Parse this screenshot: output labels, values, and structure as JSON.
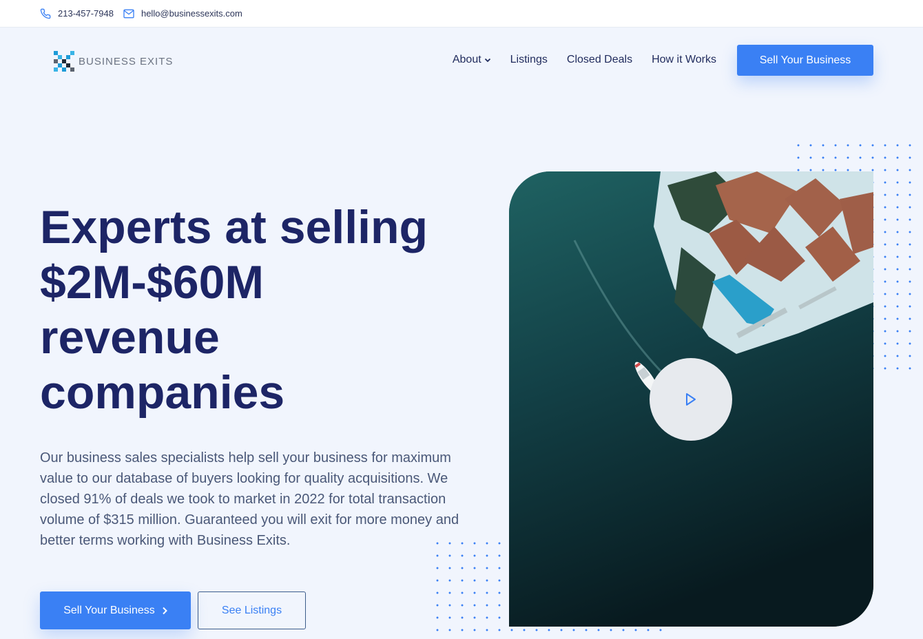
{
  "topbar": {
    "phone": "213-457-7948",
    "email": "hello@businessexits.com",
    "phone_icon": "phone-icon",
    "email_icon": "mail-icon"
  },
  "header": {
    "logo_text": "BUSINESS EXITS",
    "nav": [
      {
        "label": "About",
        "has_dropdown": true
      },
      {
        "label": "Listings"
      },
      {
        "label": "Closed Deals"
      },
      {
        "label": "How it Works"
      }
    ],
    "cta_label": "Sell Your Business"
  },
  "hero": {
    "title_lines": [
      "Experts at selling",
      "$2M-$60M",
      "revenue",
      "companies"
    ],
    "description": "Our business sales specialists help sell your business for maximum value to our database of buyers looking for quality acquisitions. We closed 91% of deals we took to market in 2022 for total transaction volume of $315 million. Guaranteed you will exit for more money and better terms working with Business Exits.",
    "primary_button": "Sell Your Business",
    "secondary_button": "See Listings"
  },
  "media": {
    "play_icon": "play-icon"
  },
  "colors": {
    "accent": "#3a80f4",
    "heading": "#1d2566",
    "background": "#f1f5fd",
    "body_text": "#4a5878"
  }
}
